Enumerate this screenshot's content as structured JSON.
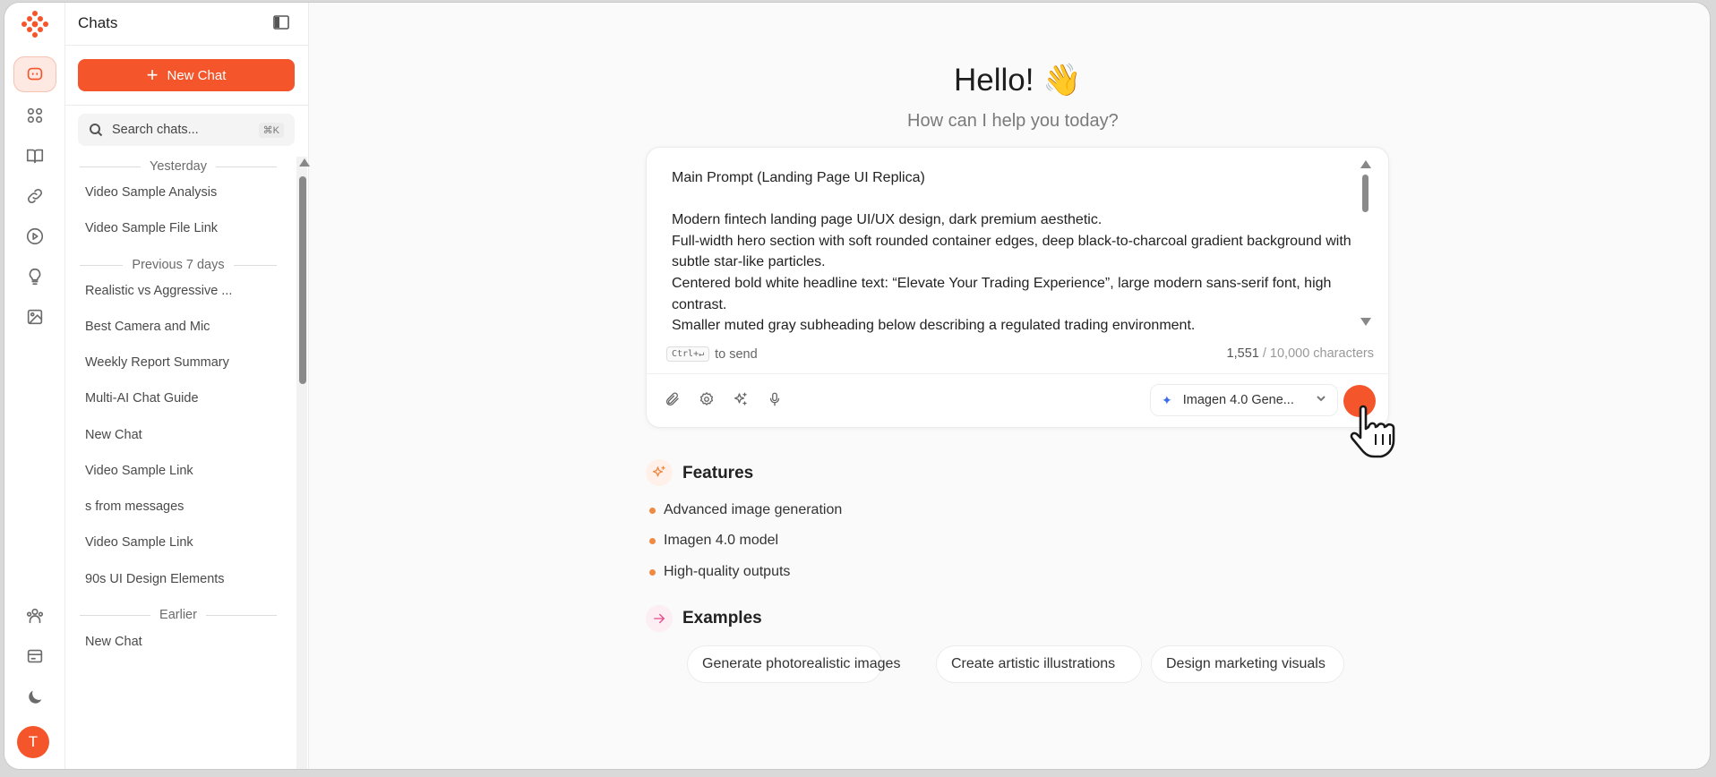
{
  "sidebar": {
    "title": "Chats",
    "new_chat_label": "New Chat",
    "search_placeholder": "Search chats...",
    "search_shortcut": "⌘K",
    "groups": [
      "Yesterday",
      "Previous 7 days",
      "Earlier"
    ],
    "chats": [
      "Video Sample Analysis",
      "Video Sample File Link",
      "Realistic vs Aggressive ...",
      "Best Camera and Mic",
      "Weekly Report Summary",
      "Multi-AI Chat Guide",
      "New Chat",
      "Video Sample Link",
      "s from messages",
      "Video Sample Link",
      "90s UI Design Elements",
      "New Chat"
    ]
  },
  "rail": {
    "avatar_initial": "T"
  },
  "main": {
    "greeting": "Hello! 👋",
    "subtitle": "How can I help you today?"
  },
  "composer": {
    "prompt_text": "Main Prompt (Landing Page UI Replica)\n\nModern fintech landing page UI/UX design, dark premium aesthetic.\nFull-width hero section with soft rounded container edges, deep black-to-charcoal gradient background with subtle star-like particles.\nCentered bold white headline text: “Elevate Your Trading Experience”, large modern sans-serif font, high contrast.\nSmaller muted gray subheading below describing a regulated trading environment.",
    "send_key": "Ctrl+↵",
    "send_hint": "to send",
    "char_count": "1,551",
    "char_limit": "/ 10,000 characters",
    "model_label": "Imagen 4.0 Gene..."
  },
  "features": {
    "title": "Features",
    "items": [
      "Advanced image generation",
      "Imagen 4.0 model",
      "High-quality outputs"
    ]
  },
  "examples": {
    "title": "Examples",
    "items": [
      "Generate photorealistic images",
      "Create artistic illustrations",
      "Design marketing visuals"
    ]
  },
  "colors": {
    "accent": "#f4552b",
    "bullet": "#f08a43",
    "examples_icon": "#e84a8a"
  }
}
